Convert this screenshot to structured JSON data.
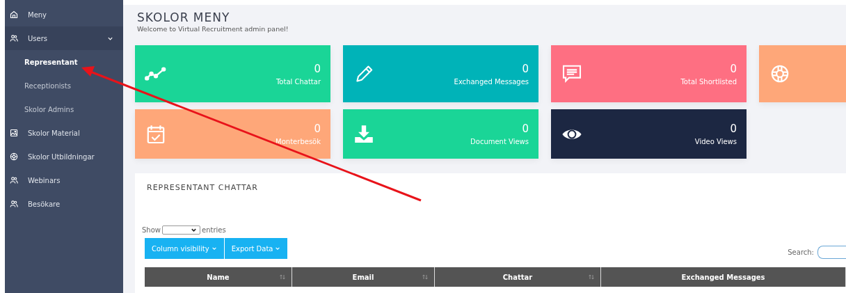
{
  "sidebar": {
    "items": [
      {
        "label": "Meny",
        "kind": "home"
      },
      {
        "label": "Users",
        "kind": "users",
        "expanded": true,
        "children": [
          {
            "label": "Representant",
            "selected": true
          },
          {
            "label": "Receptionists",
            "selected": false
          },
          {
            "label": "Skolor Admins",
            "selected": false
          }
        ]
      },
      {
        "label": "Skolor Material",
        "kind": "image"
      },
      {
        "label": "Skolor Utbildningar",
        "kind": "aperture"
      },
      {
        "label": "Webinars",
        "kind": "users"
      },
      {
        "label": "Besökare",
        "kind": "users"
      }
    ]
  },
  "header": {
    "title": "SKOLOR MENY",
    "subtitle": "Welcome to Virtual Recruitment admin panel!"
  },
  "stat_cards": [
    {
      "value": "0",
      "label": "Total Chattar",
      "kind": "trend",
      "color": "#1ad597"
    },
    {
      "value": "0",
      "label": "Exchanged Messages",
      "kind": "pencil",
      "color": "#00b3b8"
    },
    {
      "value": "0",
      "label": "Total Shortlisted",
      "kind": "message",
      "color": "#fe6f82"
    },
    {
      "kind": "lifebuoy",
      "color": "#fea779"
    },
    {
      "value": "0",
      "label": "Monterbesök",
      "kind": "calendar",
      "color": "#fea779"
    },
    {
      "value": "0",
      "label": "Document Views",
      "kind": "download",
      "color": "#1ad597"
    },
    {
      "value": "0",
      "label": "Video Views",
      "kind": "eye",
      "color": "#1c2742"
    }
  ],
  "panel": {
    "title": "REPRESENTANT CHATTAR",
    "show_label": "Show",
    "entries_label": "entries",
    "buttons": [
      "Column visibility",
      "Export Data"
    ],
    "search_label": "Search:",
    "table": {
      "columns": [
        {
          "label": "Name",
          "sortable": true
        },
        {
          "label": "Email",
          "sortable": true
        },
        {
          "label": "Chattar",
          "sortable": true
        },
        {
          "label": "Exchanged Messages",
          "sortable": false
        }
      ]
    }
  },
  "annotation": {
    "kind": "arrow"
  }
}
